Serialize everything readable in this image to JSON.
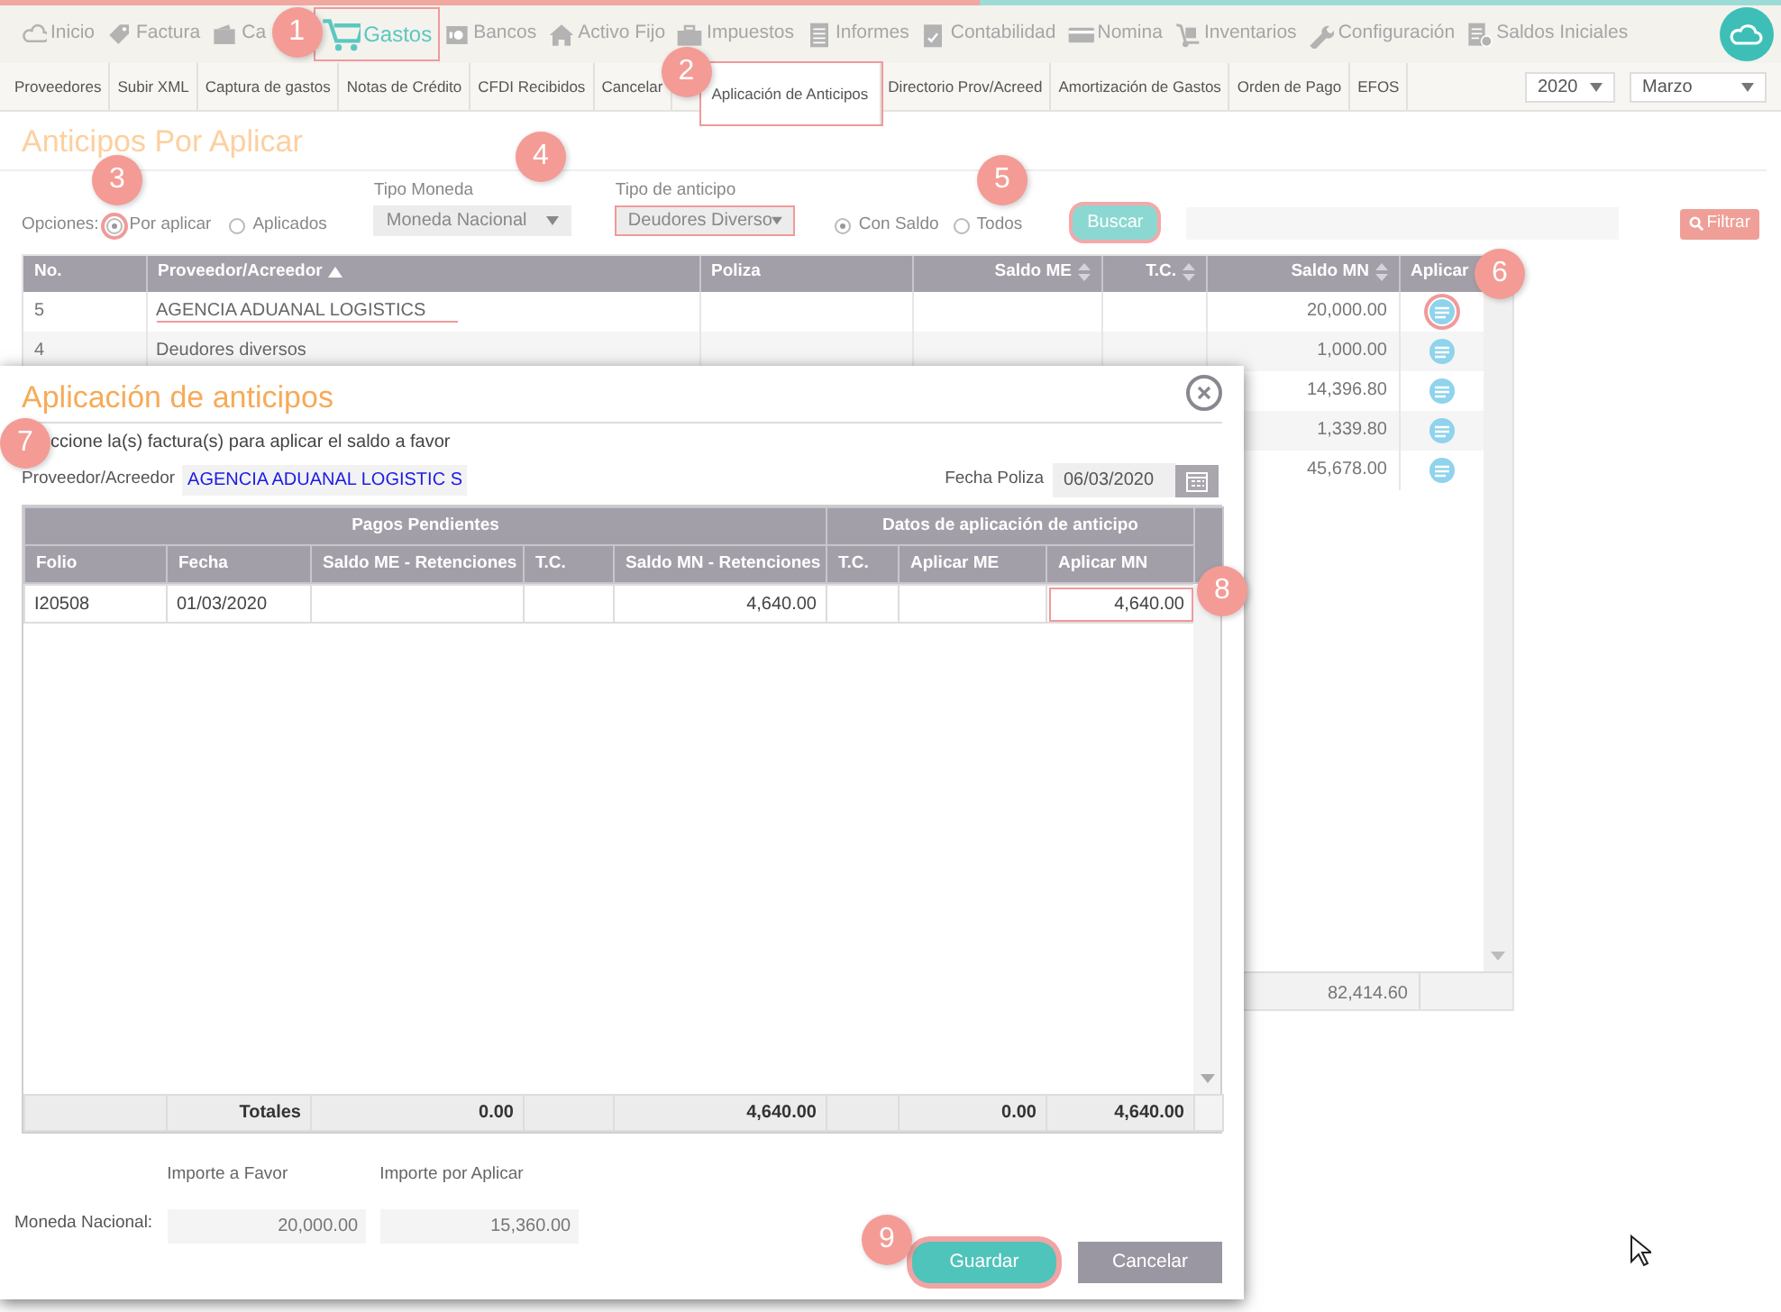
{
  "top_nav": {
    "items": [
      {
        "label": "Inicio",
        "selected": false,
        "highlighted": false
      },
      {
        "label": "Factura",
        "selected": false,
        "highlighted": false
      },
      {
        "label": "Ca",
        "selected": false,
        "highlighted": false
      },
      {
        "label": "Gastos",
        "selected": true,
        "highlighted": true
      },
      {
        "label": "Bancos",
        "selected": false,
        "highlighted": false
      },
      {
        "label": "Activo Fijo",
        "selected": false,
        "highlighted": false
      },
      {
        "label": "Impuestos",
        "selected": false,
        "highlighted": false
      },
      {
        "label": "Informes",
        "selected": false,
        "highlighted": false
      },
      {
        "label": "Contabilidad",
        "selected": false,
        "highlighted": false
      },
      {
        "label": "Nomina",
        "selected": false,
        "highlighted": false
      },
      {
        "label": "Inventarios",
        "selected": false,
        "highlighted": false
      },
      {
        "label": "Configuración",
        "selected": false,
        "highlighted": false
      },
      {
        "label": "Saldos Iniciales",
        "selected": false,
        "highlighted": false
      }
    ]
  },
  "sub_nav": {
    "items": [
      {
        "label": "Proveedores",
        "selected": false,
        "highlighted": false
      },
      {
        "label": "Subir XML",
        "selected": false,
        "highlighted": false
      },
      {
        "label": "Captura de gastos",
        "selected": false,
        "highlighted": false
      },
      {
        "label": "Notas de Crédito",
        "selected": false,
        "highlighted": false
      },
      {
        "label": "CFDI Recibidos",
        "selected": false,
        "highlighted": false
      },
      {
        "label": "Cancelar",
        "selected": false,
        "highlighted": false
      },
      {
        "label": "Aplicación de Anticipos",
        "selected": true,
        "highlighted": true
      },
      {
        "label": "Directorio Prov/Acreed",
        "selected": false,
        "highlighted": false
      },
      {
        "label": "Amortización de Gastos",
        "selected": false,
        "highlighted": false
      },
      {
        "label": "Orden de Pago",
        "selected": false,
        "highlighted": false
      },
      {
        "label": "EFOS",
        "selected": false,
        "highlighted": false
      }
    ],
    "year": "2020",
    "month": "Marzo"
  },
  "page_title": "Anticipos Por Aplicar",
  "filters": {
    "options_label": "Opciones:",
    "options": [
      {
        "label": "Por aplicar",
        "selected": true,
        "highlighted": true
      },
      {
        "label": "Aplicados",
        "selected": false,
        "highlighted": false
      }
    ],
    "tipo_moneda": {
      "label": "Tipo Moneda",
      "value": "Moneda Nacional",
      "highlighted": false
    },
    "tipo_anticipo": {
      "label": "Tipo de anticipo",
      "value": "Deudores Diverso",
      "highlighted": true
    },
    "saldo": [
      {
        "label": "Con Saldo",
        "selected": true
      },
      {
        "label": "Todos",
        "selected": false
      }
    ],
    "search_button": {
      "label": "Buscar",
      "highlighted": true
    },
    "filter_button": {
      "label": "Filtrar"
    }
  },
  "table": {
    "columns": [
      {
        "label": "No.",
        "kind": "plain"
      },
      {
        "label": "Proveedor/Acreedor",
        "kind": "sorted"
      },
      {
        "label": "Poliza",
        "kind": "plain"
      },
      {
        "label": "Saldo ME",
        "kind": "sortable"
      },
      {
        "label": "T.C.",
        "kind": "sortable"
      },
      {
        "label": "Saldo MN",
        "kind": "sortable"
      },
      {
        "label": "Aplicar",
        "kind": "plain"
      }
    ],
    "rows": [
      {
        "no": "5",
        "proveedor": "AGENCIA ADUANAL LOGISTICS",
        "saldo_mn": "20,000.00",
        "highlighted": true
      },
      {
        "no": "4",
        "proveedor": "Deudores diversos",
        "saldo_mn": "1,000.00",
        "highlighted": false
      },
      {
        "saldo_mn": "14,396.80",
        "highlighted": false
      },
      {
        "saldo_mn": "1,339.80",
        "highlighted": false
      },
      {
        "saldo_mn": "45,678.00",
        "highlighted": false
      }
    ],
    "total_saldo_mn": "82,414.60"
  },
  "modal": {
    "title": "Aplicación de anticipos",
    "instruction": "ccione la(s) factura(s) para aplicar el saldo a favor",
    "proveedor_label": "Proveedor/Acreedor",
    "proveedor_value": "AGENCIA ADUANAL LOGISTIC S",
    "fecha_label": "Fecha Poliza",
    "fecha_value": "06/03/2020",
    "groups": [
      "Pagos Pendientes",
      "Datos de aplicación de anticipo"
    ],
    "columns": [
      "Folio",
      "Fecha",
      "Saldo ME - Retenciones",
      "T.C.",
      "Saldo MN - Retenciones",
      "T.C.",
      "Aplicar ME",
      "Aplicar MN"
    ],
    "rows": [
      {
        "cells": [
          "I20508",
          "01/03/2020",
          null,
          null,
          "4,640.00",
          null,
          null,
          "4,640.00"
        ],
        "aplicar_mn_highlighted": true
      }
    ],
    "totals": {
      "label": "Totales",
      "saldo_me": "0.00",
      "saldo_mn": "4,640.00",
      "aplicar_me": "0.00",
      "aplicar_mn": "4,640.00"
    },
    "importe_favor_label": "Importe a Favor",
    "importe_aplicar_label": "Importe por Aplicar",
    "moneda_label": "Moneda Nacional:",
    "importe_favor": "20,000.00",
    "importe_aplicar": "15,360.00",
    "buttons": [
      {
        "label": "Guardar",
        "kind": "primary",
        "highlighted": true
      },
      {
        "label": "Cancelar",
        "kind": "secondary",
        "highlighted": false
      }
    ]
  },
  "callouts": [
    "1",
    "2",
    "3",
    "4",
    "5",
    "6",
    "7",
    "8",
    "9"
  ]
}
